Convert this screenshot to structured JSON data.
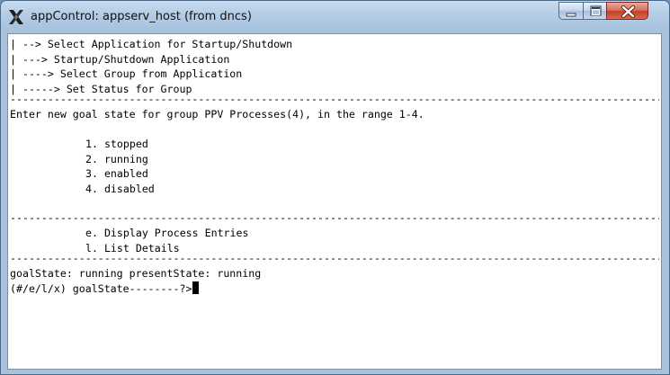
{
  "window": {
    "title": "appControl: appserv_host (from dncs)",
    "icon": "x-window-icon",
    "controls": [
      "minimize-icon",
      "maximize-icon",
      "close-icon"
    ]
  },
  "terminal": {
    "breadcrumbs": [
      "| --> Select Application for Startup/Shutdown",
      "| ---> Startup/Shutdown Application",
      "| ----> Select Group from Application",
      "| -----> Set Status for Group"
    ],
    "separator": "----------------------------------------------------------------------------------------------------------",
    "prompt_message": "Enter new goal state for group PPV Processes(4), in the range 1-4.",
    "options": [
      "1. stopped",
      "2. running",
      "3. enabled",
      "4. disabled"
    ],
    "actions": [
      "e. Display Process Entries",
      "l. List Details"
    ],
    "status_line": "goalState: running presentState: running",
    "input_prompt": "(#/e/l/x) goalState--------?>"
  },
  "colors": {
    "titlebar": "#b5cde6",
    "terminal_bg": "#ffffff",
    "terminal_fg": "#000000",
    "close_button": "#c4402a"
  }
}
